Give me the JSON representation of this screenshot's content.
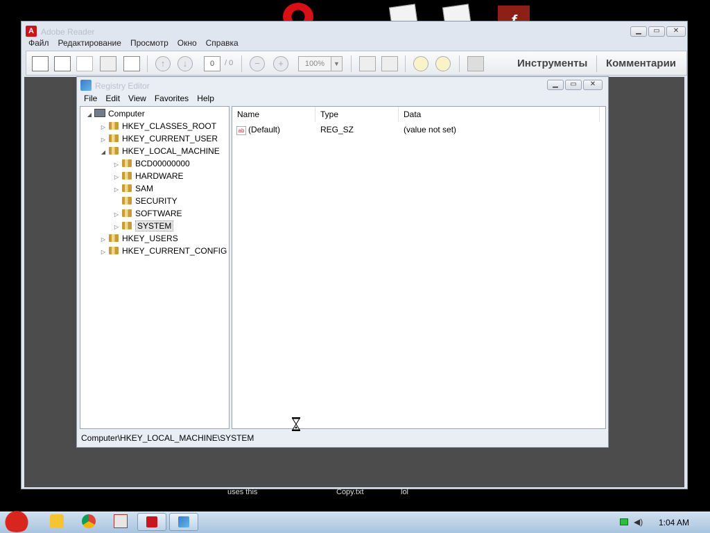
{
  "desktop": {
    "captions": [
      "uses this",
      "Copy.txt",
      "lol"
    ]
  },
  "reader": {
    "title": "Adobe Reader",
    "menu": [
      "Файл",
      "Редактирование",
      "Просмотр",
      "Окно",
      "Справка"
    ],
    "toolbar": {
      "page_current": "0",
      "page_total": "/ 0",
      "zoom": "100%",
      "tools_label": "Инструменты",
      "comments_label": "Комментарии"
    }
  },
  "regedit": {
    "title": "Registry Editor",
    "menu": [
      "File",
      "Edit",
      "View",
      "Favorites",
      "Help"
    ],
    "tree": {
      "root": "Computer",
      "hives": [
        "HKEY_CLASSES_ROOT",
        "HKEY_CURRENT_USER",
        "HKEY_LOCAL_MACHINE",
        "HKEY_USERS",
        "HKEY_CURRENT_CONFIG"
      ],
      "hklm_children": [
        "BCD00000000",
        "HARDWARE",
        "SAM",
        "SECURITY",
        "SOFTWARE",
        "SYSTEM"
      ]
    },
    "columns": [
      "Name",
      "Type",
      "Data"
    ],
    "values": [
      {
        "name": "(Default)",
        "type": "REG_SZ",
        "data": "(value not set)"
      }
    ],
    "status_path": "Computer\\HKEY_LOCAL_MACHINE\\SYSTEM"
  },
  "taskbar": {
    "clock": "1:04 AM"
  },
  "colors": {
    "reader_doc_bg": "#4c4c4c",
    "adobe_red": "#c8161d",
    "taskbar": "#b8d0e6"
  }
}
